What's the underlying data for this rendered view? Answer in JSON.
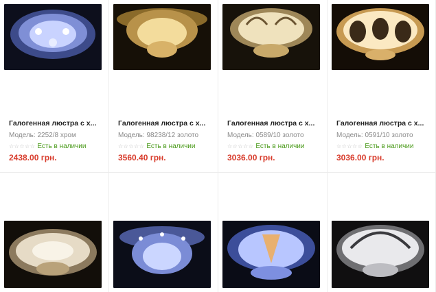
{
  "products": [
    {
      "title": "Галогенная люстра с х...",
      "model": "Модель: 2252/8 хром",
      "stars": "☆☆☆☆☆",
      "stock": "Есть в наличии",
      "price": "2438.00 грн.",
      "theme": "blue"
    },
    {
      "title": "Галогенная люстра с х...",
      "model": "Модель: 98238/12 золото",
      "stars": "☆☆☆☆☆",
      "stock": "Есть в наличии",
      "price": "3560.40 грн.",
      "theme": "gold"
    },
    {
      "title": "Галогенная люстра с х...",
      "model": "Модель: 0589/10 золото",
      "stars": "☆☆☆☆☆",
      "stock": "Есть в наличии",
      "price": "3036.00 грн.",
      "theme": "gold"
    },
    {
      "title": "Галогенная люстра с х...",
      "model": "Модель: 0591/10 золото",
      "stars": "☆☆☆☆☆",
      "stock": "Есть в наличии",
      "price": "3036.00 грн.",
      "theme": "warm"
    },
    {
      "theme": "gold"
    },
    {
      "theme": "blue"
    },
    {
      "theme": "blue"
    },
    {
      "theme": "white"
    }
  ],
  "colors": {
    "price": "#d83c2c",
    "stock": "#4a9a1a",
    "image_bg": "#0c0c10"
  },
  "icons": [
    "star-outline-icon"
  ]
}
